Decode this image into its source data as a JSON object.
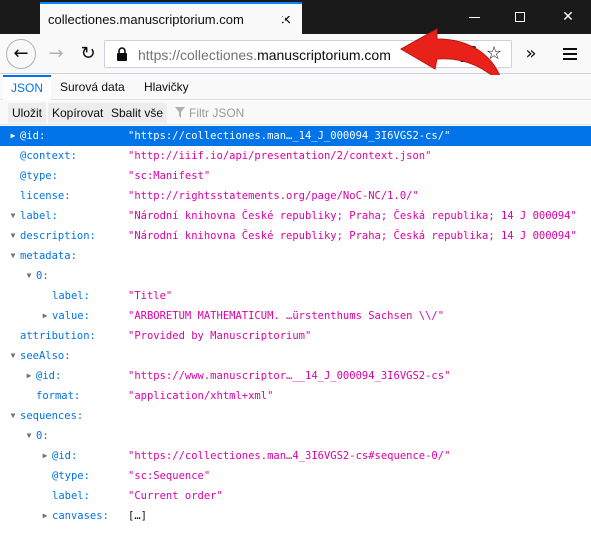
{
  "browser": {
    "tab_title": "collectiones.manuscriptorium.com",
    "tab_close": "×",
    "new_tab": "+",
    "url_prefix": "https://collectiones.",
    "url_host": "manuscriptorium.com",
    "overflow": "»",
    "back": "←",
    "forward": "→",
    "reload": "↻",
    "star": "☆",
    "win_close": "✕"
  },
  "viewer": {
    "tabs": [
      "JSON",
      "Surová data",
      "Hlavičky"
    ],
    "active_tab": "JSON",
    "toolbar": {
      "save": "Uložit",
      "copy": "Kopírovat",
      "collapse": "Sbalit vše",
      "filter_placeholder": "Filtr JSON"
    }
  },
  "tree": [
    {
      "indent": 0,
      "twisty": "▶",
      "key": "@id:",
      "value": "\"https://collectiones.man…_14_J_000094_3I6VGS2-cs/\"",
      "selected": true
    },
    {
      "indent": 0,
      "twisty": "",
      "key": "@context:",
      "value": "\"http://iiif.io/api/presentation/2/context.json\""
    },
    {
      "indent": 0,
      "twisty": "",
      "key": "@type:",
      "value": "\"sc:Manifest\""
    },
    {
      "indent": 0,
      "twisty": "",
      "key": "license:",
      "value": "\"http://rightsstatements.org/page/NoC-NC/1.0/\""
    },
    {
      "indent": 0,
      "twisty": "▼",
      "key": "label:",
      "value": "\"Národní knihovna České republiky; Praha; Česká republika; 14 J 000094\""
    },
    {
      "indent": 0,
      "twisty": "▼",
      "key": "description:",
      "value": "\"Národní knihovna České republiky; Praha; Česká republika; 14 J 000094\""
    },
    {
      "indent": 0,
      "twisty": "▼",
      "key": "metadata:",
      "value": ""
    },
    {
      "indent": 1,
      "twisty": "▼",
      "key": "0:",
      "value": ""
    },
    {
      "indent": 2,
      "twisty": "",
      "key": "label:",
      "value": "\"Title\""
    },
    {
      "indent": 2,
      "twisty": "▶",
      "key": "value:",
      "value": "\"ARBORETUM MATHEMATICUM. …ürstenthums Sachsen \\\\/\""
    },
    {
      "indent": 0,
      "twisty": "",
      "key": "attribution:",
      "value": "\"Provided by Manuscriptorium\""
    },
    {
      "indent": 0,
      "twisty": "▼",
      "key": "seeAlso:",
      "value": ""
    },
    {
      "indent": 1,
      "twisty": "▶",
      "key": "@id:",
      "value": "\"https://www.manuscriptor…__14_J_000094_3I6VGS2-cs\""
    },
    {
      "indent": 1,
      "twisty": "",
      "key": "format:",
      "value": "\"application/xhtml+xml\""
    },
    {
      "indent": 0,
      "twisty": "▼",
      "key": "sequences:",
      "value": ""
    },
    {
      "indent": 1,
      "twisty": "▼",
      "key": "0:",
      "value": ""
    },
    {
      "indent": 2,
      "twisty": "▶",
      "key": "@id:",
      "value": "\"https://collectiones.man…4_3I6VGS2-cs#sequence-0/\""
    },
    {
      "indent": 2,
      "twisty": "",
      "key": "@type:",
      "value": "\"sc:Sequence\""
    },
    {
      "indent": 2,
      "twisty": "",
      "key": "label:",
      "value": "\"Current order\""
    },
    {
      "indent": 2,
      "twisty": "▶",
      "key": "canvases:",
      "value": "[…]",
      "plain": true
    }
  ],
  "colors": {
    "accent": "#0074e8",
    "string": "#dd00a9",
    "arrow": "#e8221a",
    "titlebar": "#1a1a1a"
  },
  "icons": {
    "lock": "lock-icon",
    "star": "star-icon",
    "filter": "filter-icon",
    "menu": "hamburger-menu-icon"
  }
}
